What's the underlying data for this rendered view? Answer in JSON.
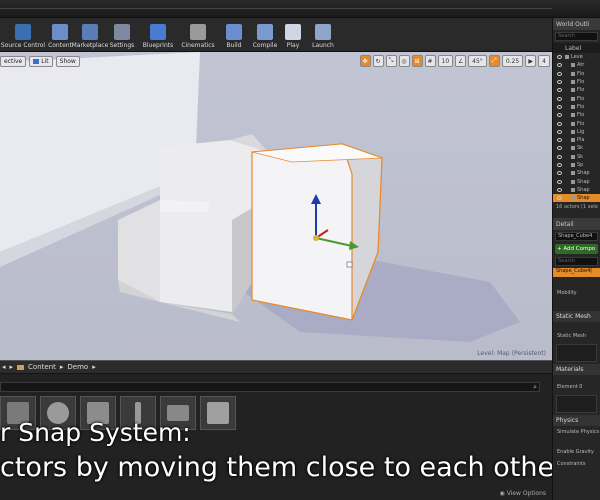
{
  "toolbar": {
    "items": [
      {
        "label": "Source Control",
        "icon": "source-control-icon",
        "color": "#3a6fb0"
      },
      {
        "label": "Content",
        "icon": "content-icon",
        "color": "#6b8ec9"
      },
      {
        "label": "Marketplace",
        "icon": "marketplace-icon",
        "color": "#5b7cb8"
      },
      {
        "label": "Settings",
        "icon": "settings-gear-icon",
        "color": "#7d8aa0"
      },
      {
        "label": "Blueprints",
        "icon": "blueprints-icon",
        "color": "#4a7bd0"
      },
      {
        "label": "Cinematics",
        "icon": "cinematics-icon",
        "color": "#9a9a9a"
      },
      {
        "label": "Build",
        "icon": "build-icon",
        "color": "#6a8fd0"
      },
      {
        "label": "Compile",
        "icon": "compile-icon",
        "color": "#7c9ad2"
      },
      {
        "label": "Play",
        "icon": "play-icon",
        "color": "#cfd6e6"
      },
      {
        "label": "Launch",
        "icon": "launch-icon",
        "color": "#8ea4c8"
      }
    ]
  },
  "viewport": {
    "left_tools": [
      "ective",
      "Lit",
      "Show"
    ],
    "right_values": {
      "grid": "10",
      "rotation": "45°",
      "scale": "0.25",
      "camera_speed": "4"
    },
    "level_label": "Level:  Map (Persistent)",
    "accent": "#e68a2a"
  },
  "content_browser": {
    "path": [
      "Content",
      "Demo"
    ],
    "view_options": "View Options"
  },
  "subtitles": {
    "line1": "r Snap System:",
    "line2": "ctors by moving them close to each othe"
  },
  "outliner": {
    "title": "World Outli",
    "search_placeholder": "Search",
    "column_label": "Label",
    "rows": [
      "Leve",
      "Atr",
      "Flo",
      "Flo",
      "Flo",
      "Flo",
      "Flo",
      "Flo",
      "Flo",
      "Lig",
      "Pla",
      "Sk",
      "Sk",
      "Sp",
      "Shap",
      "Shap",
      "Shap",
      "Shap"
    ],
    "selected_index": 17,
    "count": "16 actors (1 sele"
  },
  "details": {
    "title": "Detail",
    "selected_name": "Shape_Cube4",
    "add_component": "+ Add Compo",
    "search_placeholder": "Search",
    "component_selected": "Shape_Cube4(",
    "mobility_label": "Mobility",
    "static_mesh_section": "Static Mesh",
    "static_mesh_label": "Static Mesh",
    "materials_section": "Materials",
    "element_label": "Element 0",
    "physics_section": "Physics",
    "simulate_label": "Simulate Physics",
    "enable_gravity_label": "Enable Gravity",
    "constraints_label": "Constraints"
  }
}
